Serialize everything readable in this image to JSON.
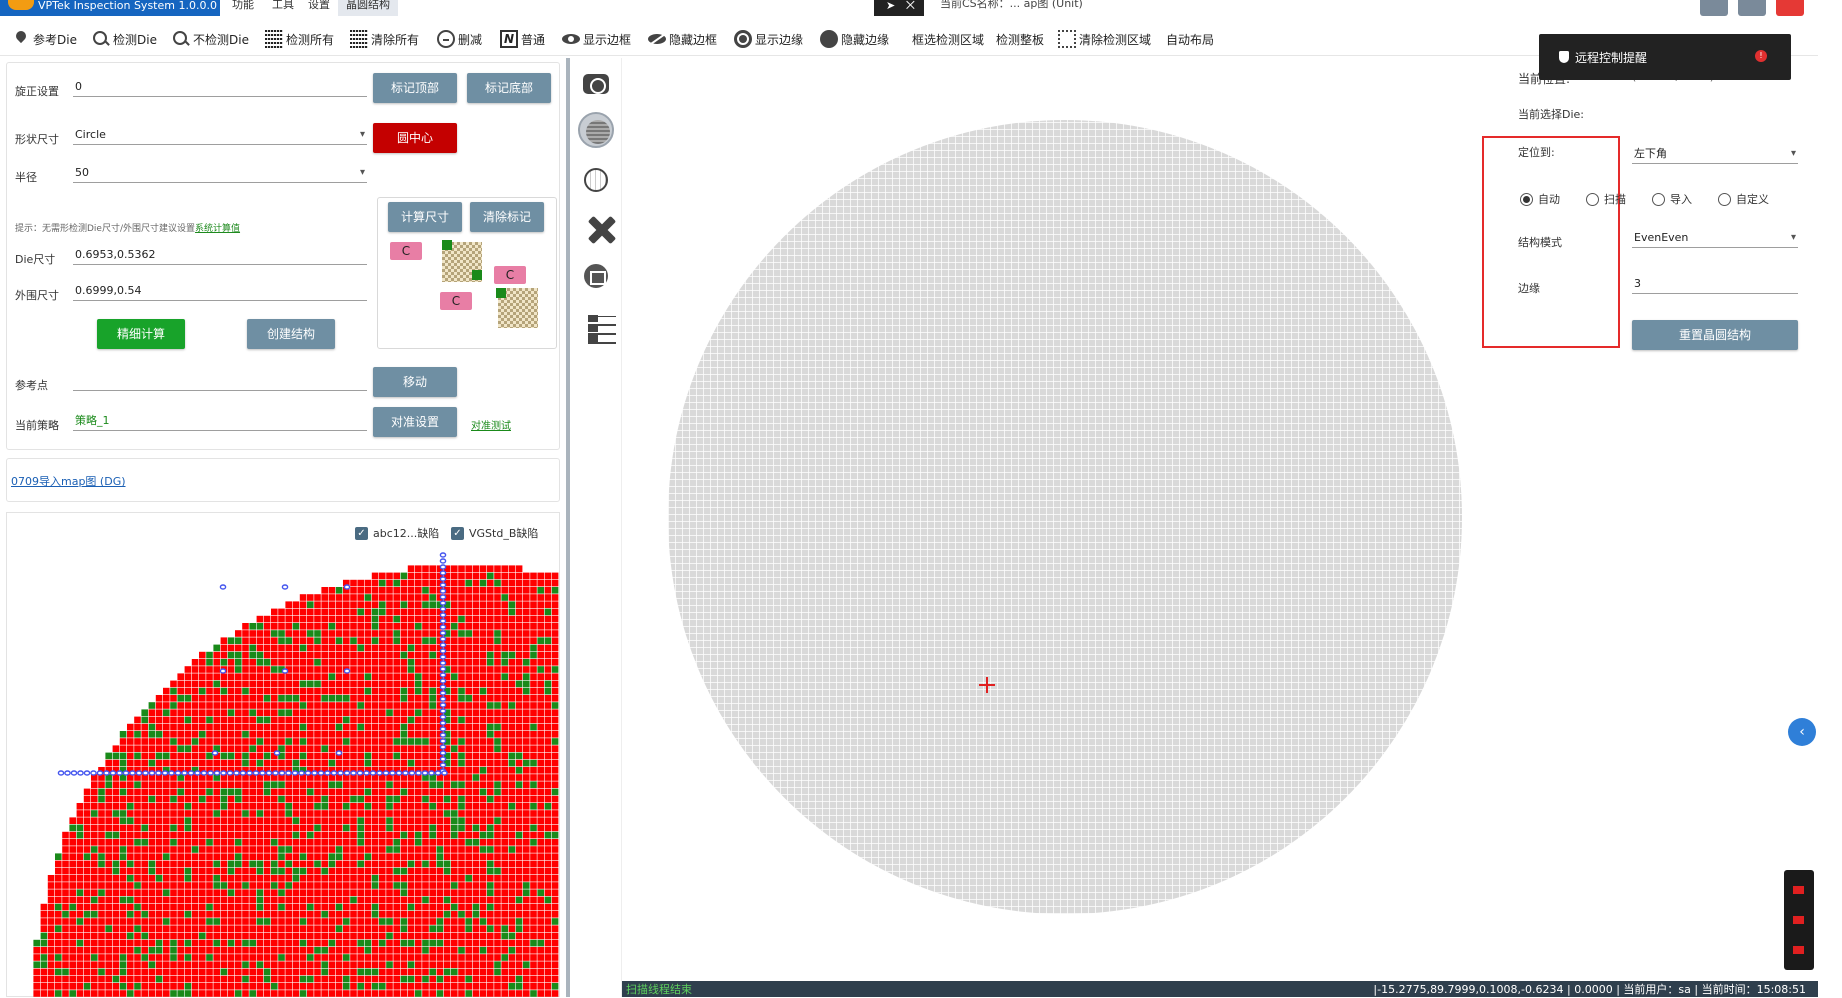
{
  "window": {
    "app_title": "VPTek Inspection System 1.0.0.0",
    "menus": [
      "功能",
      "工具",
      "设置",
      "晶圆结构"
    ],
    "doc_title": "当前CS名称：... ap图 (Unit)",
    "remote_label": "⨉"
  },
  "toolbar": {
    "items": [
      "参考Die",
      "检测Die",
      "不检测Die",
      "检测所有",
      "清除所有",
      "删减",
      "普通",
      "显示边框",
      "隐藏边框",
      "显示边缘",
      "隐藏边缘",
      "框选检测区域",
      "检测整板",
      "清除检测区域",
      "自动布局"
    ]
  },
  "left": {
    "rotation_label": "旋正设置",
    "rotation_value": "0",
    "mark_top": "标记顶部",
    "mark_bottom": "标记底部",
    "shape_label": "形状尺寸",
    "shape_value": "Circle",
    "center_btn": "圆中心",
    "radius_label": "半径",
    "radius_value": "50",
    "calc_btn": "计算尺寸",
    "clear_btn": "清除标记",
    "hint_text": "提示：无需形检测Die尺寸/外围尺寸建议设置",
    "hint_link": "系统计算值",
    "die_label": "Die尺寸",
    "die_value": "0.6953,0.5362",
    "outer_label": "外围尺寸",
    "outer_value": "0.6999,0.54",
    "fine_btn": "精细计算",
    "create_btn": "创建结构",
    "ref_label": "参考点",
    "ref_value": "",
    "move_btn": "移动",
    "strategy_label": "当前策略",
    "strategy_value": "策略_1",
    "align_btn": "对准设置",
    "align_link": "对准测试",
    "c_label": "C",
    "map_link": "0709导入map图 (DG)",
    "check1": "abc12...缺陷",
    "check2": "VGStd_B缺陷"
  },
  "right": {
    "current_pos_label": "当前位置:",
    "current_pos_value": "(104.85,45.73)",
    "selected_die_label": "当前选择Die:",
    "locate_label": "定位到:",
    "locate_value": "左下角",
    "radio_auto": "自动",
    "radio_scan": "扫描",
    "radio_import": "导入",
    "radio_custom": "自定义",
    "struct_label": "结构模式",
    "struct_value": "EvenEven",
    "edge_label": "边缘",
    "edge_value": "3",
    "reset_btn": "重置晶圆结构"
  },
  "toast": {
    "text": "远程控制提醒",
    "badge": "!"
  },
  "status": {
    "left": "扫描线程结束",
    "coords": "-15.2775,89.7999,0.1008,-0.6234",
    "value": "0.0000",
    "user_label": "当前用户：sa",
    "time_label": "当前时间：15:08:51"
  },
  "colors": {
    "accent": "#1565c0",
    "defect": "#ff0000",
    "good": "#1a8a1a",
    "wafer": "#d9d9d9"
  }
}
